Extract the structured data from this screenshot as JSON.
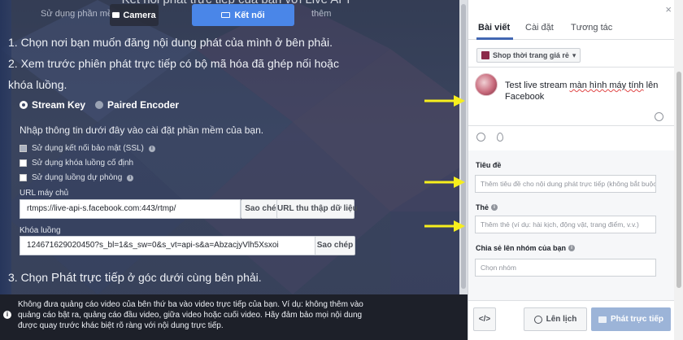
{
  "stage": {
    "title": "Kết nối phát trực tiếp của bạn với Live API",
    "subtitle": "Sử dụng phần mềm",
    "subtitle_right": "thêm",
    "tab_camera": "Camera",
    "tab_connect": "Kết nối",
    "step1": "1. Chọn nơi bạn muốn đăng nội dung phát của mình ở bên phải.",
    "step2": "2. Xem trước phiên phát trực tiếp có bộ mã hóa đã ghép nối hoặc khóa luồng.",
    "step3_pre": "3. Chọn ",
    "step3_bold": "Phát trực tiếp",
    "step3_post": " ở góc dưới cùng bên phải.",
    "radio_stream_key": "Stream Key",
    "radio_paired_encoder": "Paired Encoder",
    "panel_desc": "Nhập thông tin dưới đây vào cài đặt phần mềm của bạn.",
    "chk_ssl": "Sử dụng kết nối bảo mật (SSL)",
    "chk_fixed_key": "Sử dụng khóa luồng cố định",
    "chk_backup": "Sử dụng luồng dự phòng",
    "server_url_label": "URL máy chủ",
    "server_url_value": "rtmps://live-api-s.facebook.com:443/rtmp/",
    "copy_label": "Sao chép",
    "data_url_label": "URL thu thập dữ liệu",
    "stream_key_label": "Khóa luồng",
    "stream_key_value": "124671629020450?s_bl=1&s_sw=0&s_vt=api-s&a=AbzacjyVlh5Xsxoi",
    "notice": "Không đưa quảng cáo video của bên thứ ba vào video trực tiếp của bạn. Ví dụ: không thêm vào quảng cáo bật ra, quảng cáo đầu video, giữa video hoặc cuối video. Hãy đảm bảo mọi nội dung được quay trước khác biệt rõ ràng với nội dung trực tiếp."
  },
  "side": {
    "close": "×",
    "tabs": [
      "Bài viết",
      "Cài đặt",
      "Tương tác"
    ],
    "page_selector": "Shop thời trang giá rẻ",
    "post_text_pre": "Test live stream ",
    "post_text_sq": "màn hình máy tính",
    "post_text_post": " lên Facebook",
    "title_label": "Tiêu đề",
    "title_placeholder": "Thêm tiêu đề cho nội dung phát trực tiếp (không bắt buộc)",
    "tags_label": "Thẻ",
    "tags_placeholder": "Thêm thẻ (ví dụ: hài kịch, động vật, trang điểm, v.v.)",
    "group_label": "Chia sẻ lên nhóm của bạn",
    "group_placeholder": "Chọn nhóm",
    "code_btn": "</>",
    "schedule_btn": "Lên lịch",
    "live_btn": "Phát trực tiếp"
  },
  "colors": {
    "accent": "#4267b2",
    "connect_tab": "#4a86e8",
    "arrow": "#f7ef1d"
  }
}
